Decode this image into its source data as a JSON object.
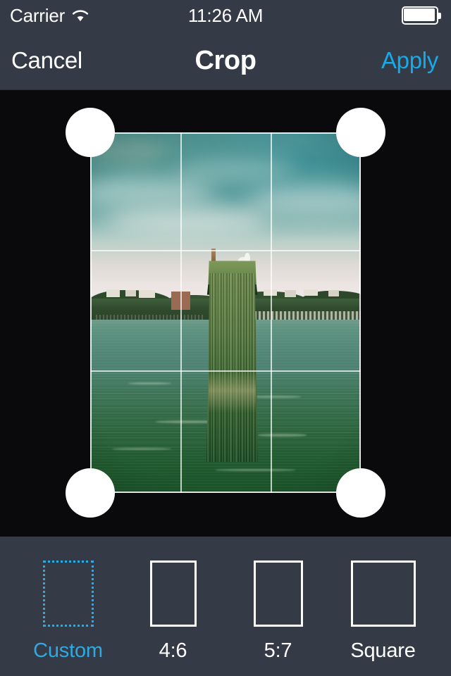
{
  "status_bar": {
    "carrier": "Carrier",
    "wifi_icon": "wifi-icon",
    "time": "11:26 AM",
    "battery_icon": "battery-full-icon"
  },
  "nav_bar": {
    "cancel_label": "Cancel",
    "title": "Crop",
    "apply_label": "Apply",
    "apply_color": "#18a9e8",
    "background": "#343a46"
  },
  "editor": {
    "photo_description": "Cluster of weathered wooden pilings in green harbor water with a seagull perched on top, distant tree-lined shore with buildings under a teal sky",
    "crop_grid": {
      "columns": 3,
      "rows": 3,
      "visible": true
    },
    "handles": [
      {
        "name": "top-left"
      },
      {
        "name": "top-right"
      },
      {
        "name": "bottom-left"
      },
      {
        "name": "bottom-right"
      }
    ]
  },
  "toolbar": {
    "background": "#343a46",
    "selected": "Custom",
    "accent_color": "#2fa9e0",
    "ratios": [
      {
        "label": "Custom",
        "selected": true
      },
      {
        "label": "4:6",
        "selected": false
      },
      {
        "label": "5:7",
        "selected": false
      },
      {
        "label": "Square",
        "selected": false
      }
    ]
  }
}
